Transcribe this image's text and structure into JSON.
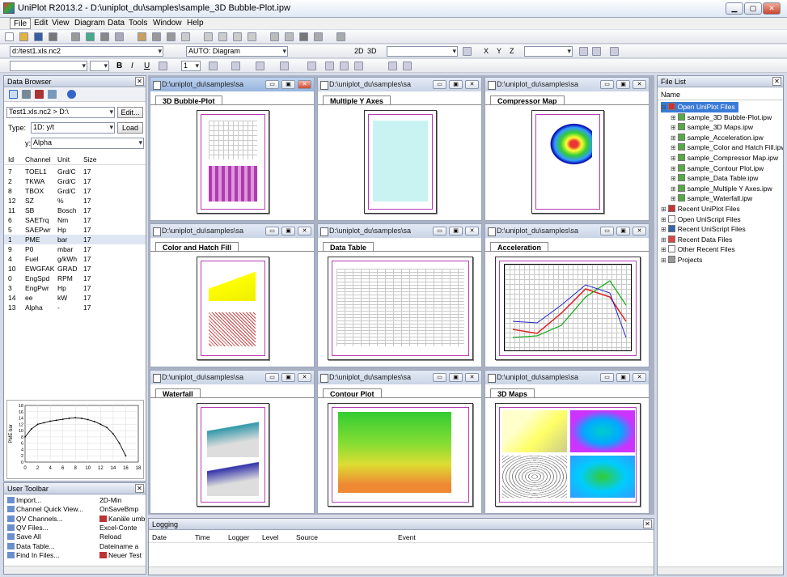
{
  "app": {
    "title": "UniPlot R2013.2 - D:\\uniplot_du\\samples\\sample_3D Bubble-Plot.ipw",
    "min": "▁",
    "max": "▢",
    "close": "✕"
  },
  "menu": [
    "File",
    "Edit",
    "View",
    "Diagram",
    "Data",
    "Tools",
    "Window",
    "Help"
  ],
  "toolbar": {
    "file_combo": "d:/test1.xls.nc2",
    "diagram_combo": "AUTO: Diagram",
    "view_2d": "2D",
    "view_3d": "3D",
    "x_label": "X",
    "y_label": "Y",
    "z_label": "Z",
    "line_width": "1",
    "bold": "B",
    "italic": "I",
    "underline": "U"
  },
  "data_browser": {
    "title": "Data Browser",
    "file_path": "Test1.xls.nc2  >  D:\\",
    "edit_btn": "Edit...",
    "type_label": "Type:",
    "type_value": "1D: y/t",
    "load_btn": "Load",
    "y_label": "y:",
    "y_value": "Alpha",
    "columns": [
      "Id",
      "Channel",
      "Unit",
      "Size"
    ],
    "rows": [
      [
        "7",
        "TOEL1",
        "Grd/C",
        "17"
      ],
      [
        "2",
        "TKWA",
        "Grd/C",
        "17"
      ],
      [
        "8",
        "TBOX",
        "Grd/C",
        "17"
      ],
      [
        "12",
        "SZ",
        "%",
        "17"
      ],
      [
        "11",
        "SB",
        "Bosch",
        "17"
      ],
      [
        "6",
        "SAETrq",
        "Nm",
        "17"
      ],
      [
        "5",
        "SAEPwr",
        "Hp",
        "17"
      ],
      [
        "1",
        "PME",
        "bar",
        "17"
      ],
      [
        "9",
        "P0",
        "mbar",
        "17"
      ],
      [
        "4",
        "Fuel",
        "g/kWh",
        "17"
      ],
      [
        "10",
        "EWGFAK",
        "GRAD",
        "17"
      ],
      [
        "0",
        "EngSpd",
        "RPM",
        "17"
      ],
      [
        "3",
        "EngPwr",
        "Hp",
        "17"
      ],
      [
        "14",
        "ee",
        "kW",
        "17"
      ],
      [
        "13",
        "Alpha",
        "-",
        "17"
      ]
    ]
  },
  "preview_chart": {
    "ylabel": "PME bar",
    "xticks": [
      "0",
      "2",
      "4",
      "6",
      "8",
      "10",
      "12",
      "14",
      "16",
      "18"
    ],
    "yticks": [
      "18",
      "16",
      "14",
      "12",
      "10",
      "8",
      "6",
      "4",
      "2",
      "0"
    ]
  },
  "chart_data": {
    "type": "line",
    "x": [
      0,
      1,
      2,
      3,
      4,
      5,
      6,
      7,
      8,
      9,
      10,
      11,
      12,
      13,
      14,
      15,
      16
    ],
    "values": [
      8.0,
      10.5,
      12.0,
      12.5,
      13.0,
      13.3,
      13.6,
      13.9,
      14.1,
      13.9,
      13.5,
      12.9,
      12.0,
      11.0,
      9.0,
      6.0,
      2.0
    ],
    "ylabel": "PME bar",
    "xlim": [
      0,
      18
    ],
    "ylim": [
      0,
      18
    ]
  },
  "user_toolbar": {
    "title": "User Toolbar",
    "left": [
      "Import...",
      "Channel Quick View...",
      "QV Channels...",
      "QV Files...",
      "Save All",
      "Data Table...",
      "Find In Files..."
    ],
    "right": [
      "2D-Min",
      "OnSaveBmp",
      "Kanäle umb",
      "Excel-Conte",
      "Reload",
      "Dateiname a",
      "Neuer Test"
    ]
  },
  "windows": [
    {
      "caption": "D:\\uniplot_du\\samples\\sa",
      "tab": "3D Bubble-Plot"
    },
    {
      "caption": "D:\\uniplot_du\\samples\\sa",
      "tab": "Multiple Y Axes"
    },
    {
      "caption": "D:\\uniplot_du\\samples\\sa",
      "tab": "Compressor Map"
    },
    {
      "caption": "D:\\uniplot_du\\samples\\sa",
      "tab": "Color and Hatch Fill"
    },
    {
      "caption": "D:\\uniplot_du\\samples\\sa",
      "tab": "Data Table"
    },
    {
      "caption": "D:\\uniplot_du\\samples\\sa",
      "tab": "Acceleration"
    },
    {
      "caption": "D:\\uniplot_du\\samples\\sa",
      "tab": "Waterfall"
    },
    {
      "caption": "D:\\uniplot_du\\samples\\sa",
      "tab": "Contour Plot"
    },
    {
      "caption": "D:\\uniplot_du\\samples\\sa",
      "tab": "3D Maps"
    }
  ],
  "logging": {
    "title": "Logging",
    "columns": [
      "Date",
      "Time",
      "Logger",
      "Level",
      "Source",
      "Event"
    ]
  },
  "file_list": {
    "title": "File List",
    "header": "Name",
    "items": [
      {
        "label": "Open UniPlot Files",
        "level": 0,
        "selected": true,
        "exp": "⊟",
        "color": "#c33"
      },
      {
        "label": "sample_3D Bubble-Plot.ipw",
        "level": 1,
        "exp": "⊞",
        "color": "#5a4"
      },
      {
        "label": "sample_3D Maps.ipw",
        "level": 1,
        "exp": "⊞",
        "color": "#5a4"
      },
      {
        "label": "sample_Acceleration.ipw",
        "level": 1,
        "exp": "⊞",
        "color": "#5a4"
      },
      {
        "label": "sample_Color and Hatch Fill.ipw",
        "level": 1,
        "exp": "⊞",
        "color": "#5a4"
      },
      {
        "label": "sample_Compressor Map.ipw",
        "level": 1,
        "exp": "⊞",
        "color": "#5a4"
      },
      {
        "label": "sample_Contour Plot.ipw",
        "level": 1,
        "exp": "⊞",
        "color": "#5a4"
      },
      {
        "label": "sample_Data Table.ipw",
        "level": 1,
        "exp": "⊞",
        "color": "#5a4"
      },
      {
        "label": "sample_Multiple Y Axes.ipw",
        "level": 1,
        "exp": "⊞",
        "color": "#5a4"
      },
      {
        "label": "sample_Waterfall.ipw",
        "level": 1,
        "exp": "⊞",
        "color": "#5a4"
      },
      {
        "label": "Recent UniPlot Files",
        "level": 0,
        "exp": "⊞",
        "color": "#c33"
      },
      {
        "label": "Open UniScript Files",
        "level": 0,
        "exp": "⊞",
        "color": "#fff"
      },
      {
        "label": "Recent UniScript Files",
        "level": 0,
        "exp": "⊞",
        "color": "#36a"
      },
      {
        "label": "Recent Data Files",
        "level": 0,
        "exp": "⊞",
        "color": "#d44"
      },
      {
        "label": "Other Recent Files",
        "level": 0,
        "exp": "⊞",
        "color": "#fff"
      },
      {
        "label": "Projects",
        "level": 0,
        "exp": "⊞",
        "color": "#999"
      }
    ]
  }
}
